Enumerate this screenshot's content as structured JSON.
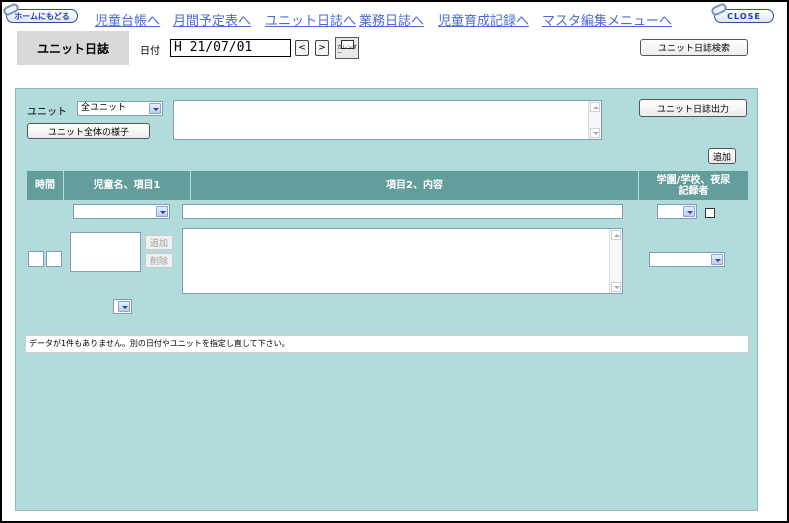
{
  "nav": {
    "home_label": "ホームにもどる",
    "close_label": "CLOSE",
    "links": [
      "児童台帳へ",
      "月間予定表へ",
      "ユニット日誌へ",
      "業務日誌へ",
      "児童育成記録へ",
      "マスタ編集メニューへ"
    ]
  },
  "header": {
    "page_title": "ユニット日誌",
    "date_label": "日付",
    "date_value": "H 21/07/01",
    "prev_label": "<",
    "next_label": ">",
    "calendar_label": "カレンダー",
    "search_button": "ユニット日誌検索"
  },
  "unit": {
    "label": "ユニット",
    "selected": "全ユニット",
    "overall_button": "ユニット全体の様子",
    "output_button": "ユニット日誌出力",
    "add_button": "追加"
  },
  "table": {
    "headers": [
      "時間",
      "児童名、項目1",
      "項目2、内容",
      "学園/学校、夜尿\n記録者"
    ],
    "row_add_button": "追加",
    "row_delete_button": "削除"
  },
  "message": "データが1件もありません。別の日付やユニットを指定し直して下さい。",
  "colors": {
    "panel_bg": "#b2dcdb",
    "header_bg": "#639e9c",
    "link_color": "#4a6ad6"
  }
}
